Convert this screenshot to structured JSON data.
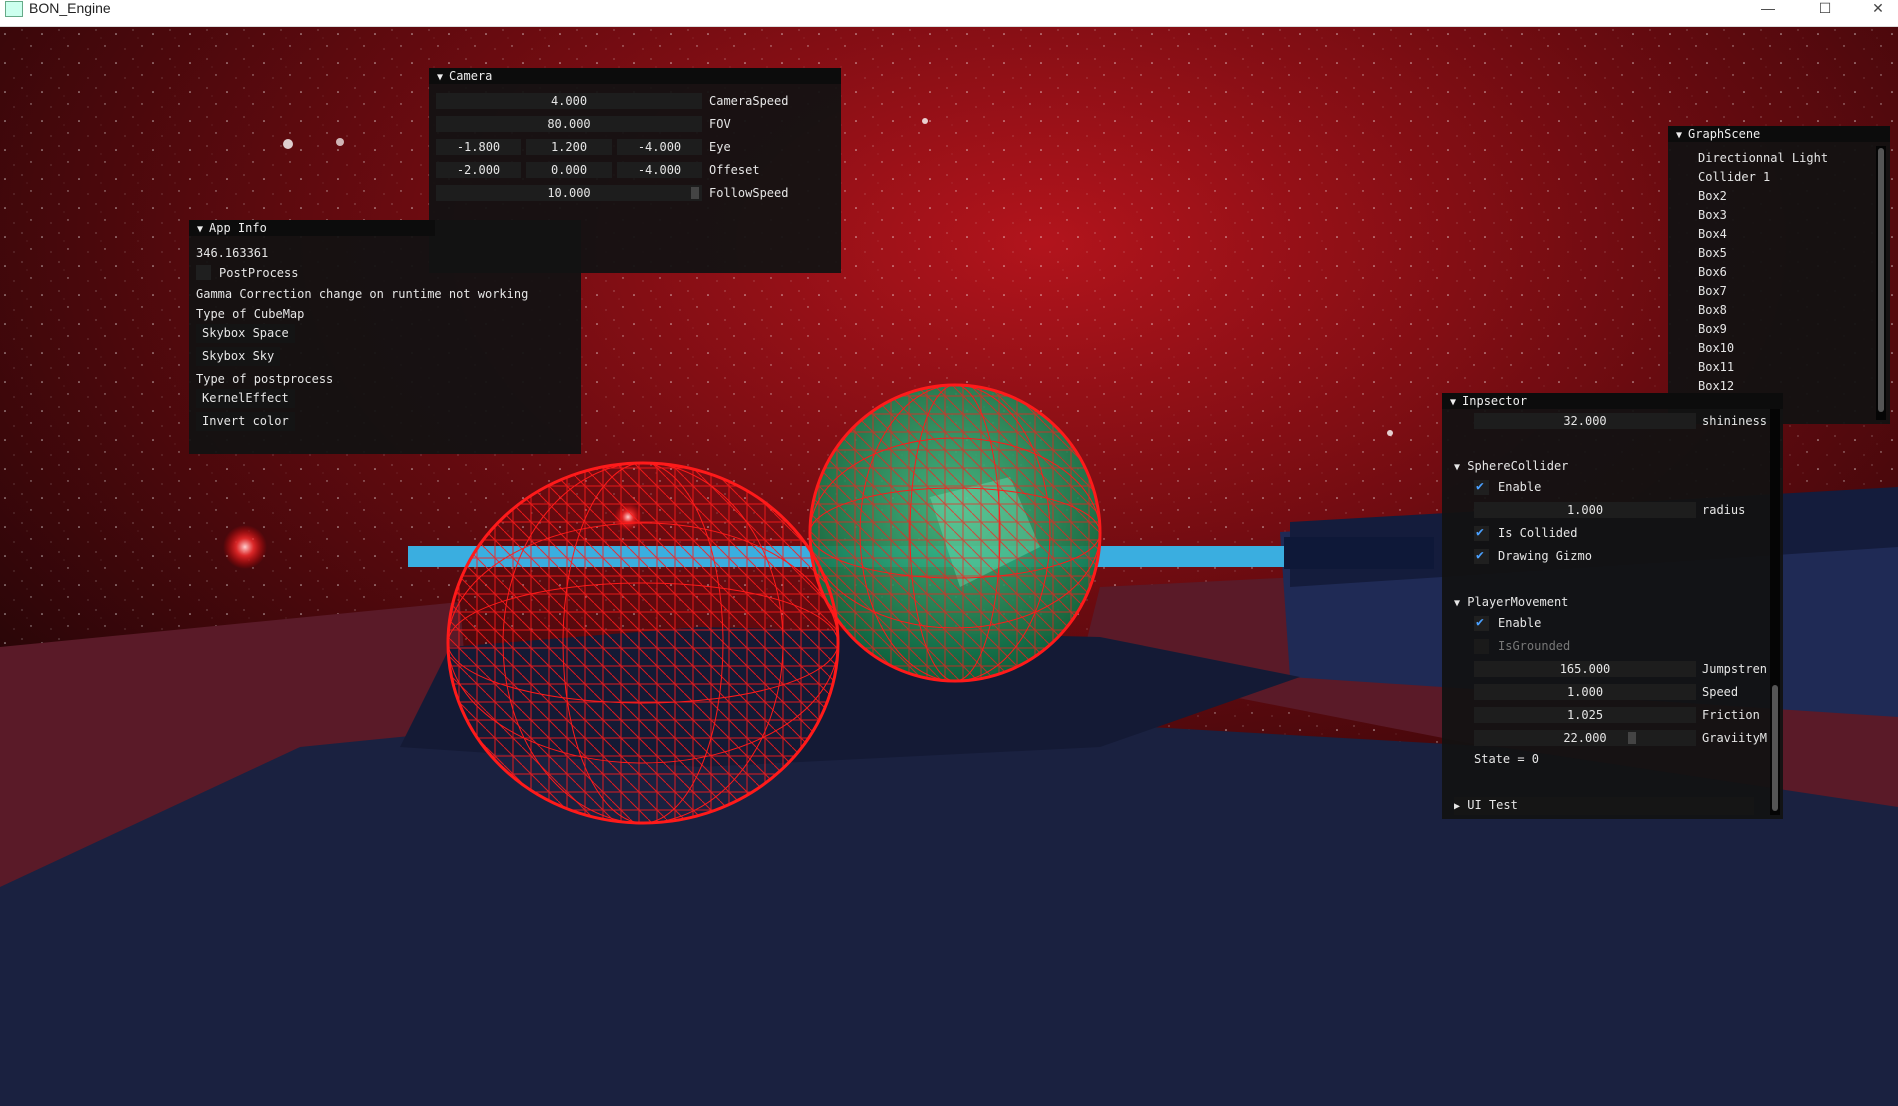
{
  "window": {
    "title": "BON_Engine",
    "minimize": "—",
    "maximize": "☐",
    "close": "✕"
  },
  "camera": {
    "title": "Camera",
    "rows": [
      {
        "values": [
          "4.000"
        ],
        "label": "CameraSpeed"
      },
      {
        "values": [
          "80.000"
        ],
        "label": "FOV"
      },
      {
        "values": [
          "-1.800",
          "1.200",
          "-4.000"
        ],
        "label": "Eye"
      },
      {
        "values": [
          "-2.000",
          "0.000",
          "-4.000"
        ],
        "label": "Offeset"
      },
      {
        "values": [
          "10.000"
        ],
        "label": "FollowSpeed"
      }
    ]
  },
  "app_info": {
    "title": "App Info",
    "fps": "346.163361",
    "postprocess_label": "PostProcess",
    "postprocess_checked": false,
    "gamma_note": "Gamma Correction change on runtime not working",
    "cubemap_label": "Type of CubeMap",
    "cubemap_buttons": [
      "Skybox Space",
      "Skybox Sky"
    ],
    "postprocess_type_label": "Type of postprocess",
    "postprocess_buttons": [
      "KernelEffect",
      "Invert color"
    ]
  },
  "graph_scene": {
    "title": "GraphScene",
    "items": [
      "Directionnal Light",
      "Collider 1",
      "Box2",
      "Box3",
      "Box4",
      "Box5",
      "Box6",
      "Box7",
      "Box8",
      "Box9",
      "Box10",
      "Box11",
      "Box12"
    ]
  },
  "inspector": {
    "title": "Inpsector",
    "shininess": {
      "value": "32.000",
      "label": "shininess"
    },
    "sphere_collider": {
      "title": "SphereCollider",
      "enable_label": "Enable",
      "enable": true,
      "radius": {
        "value": "1.000",
        "label": "radius"
      },
      "is_collided_label": "Is Collided",
      "is_collided": true,
      "drawing_gizmo_label": "Drawing Gizmo",
      "drawing_gizmo": true
    },
    "player_movement": {
      "title": "PlayerMovement",
      "enable_label": "Enable",
      "enable": true,
      "is_grounded_label": "IsGrounded",
      "is_grounded": false,
      "jump_strength": {
        "value": "165.000",
        "label": "Jumpstren"
      },
      "speed": {
        "value": "1.000",
        "label": "Speed"
      },
      "friction": {
        "value": "1.025",
        "label": "Friction"
      },
      "gravity": {
        "value": "22.000",
        "label": "GraviityM"
      },
      "state_text": "State  = 0"
    },
    "ui_test": {
      "title": "UI Test"
    }
  },
  "colors": {
    "gizmo_red": "#ff1a1a",
    "sphere_green": "#1fa060",
    "beam_blue": "#3aaee0",
    "floor_navy": "#1a2140",
    "platform_red": "#5a1a28",
    "space_red": "#8a0f14",
    "checkmark_blue": "#4aa0ff"
  }
}
